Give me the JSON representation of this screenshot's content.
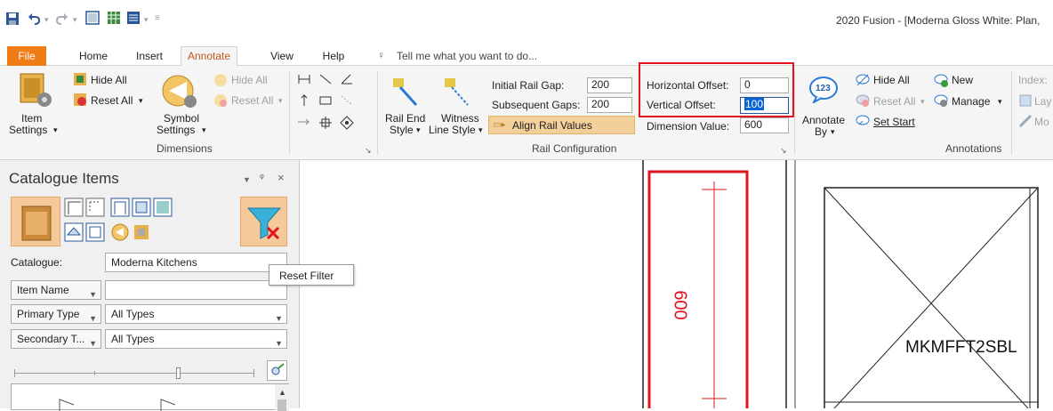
{
  "window": {
    "title": "2020 Fusion - [Moderna Gloss White: Plan,"
  },
  "tabs": {
    "file": "File",
    "home": "Home",
    "insert": "Insert",
    "annotate": "Annotate",
    "view": "View",
    "help": "Help",
    "tell_me": "Tell me what you want to do..."
  },
  "dimensions": {
    "hide_all": "Hide All",
    "reset_all": "Reset All",
    "item_settings_1": "Item",
    "item_settings_2": "Settings",
    "symbol_hide_all": "Hide All",
    "symbol_reset_all": "Reset All",
    "symbol_settings_1": "Symbol",
    "symbol_settings_2": "Settings",
    "group_label": "Dimensions"
  },
  "rail": {
    "rail_end_1": "Rail End",
    "rail_end_2": "Style",
    "witness_1": "Witness",
    "witness_2": "Line Style",
    "initial_gap_label": "Initial Rail Gap:",
    "initial_gap_value": "200",
    "subsequent_label": "Subsequent Gaps:",
    "subsequent_value": "200",
    "align": "Align Rail Values",
    "horizontal_label": "Horizontal Offset:",
    "horizontal_value": "0",
    "vertical_label": "Vertical Offset:",
    "vertical_value": "100",
    "dimension_label": "Dimension Value:",
    "dimension_value": "600",
    "group_label": "Rail Configuration"
  },
  "annotations": {
    "badge": "123",
    "annotate_1": "Annotate",
    "annotate_2": "By",
    "hide_all": "Hide All",
    "reset_all": "Reset All",
    "set_start": "Set Start",
    "new": "New",
    "manage": "Manage",
    "index": "Index:",
    "lay": "Lay",
    "mo": "Mo",
    "group_label": "Annotations"
  },
  "panel": {
    "title": "Catalogue Items",
    "catalogue_label": "Catalogue:",
    "catalogue_value": "Moderna Kitchens",
    "reset_filter": "Reset Filter",
    "item_name": "Item Name",
    "primary_type": "Primary Type",
    "primary_value": "All Types",
    "secondary_type": "Secondary T...",
    "secondary_value": "All Types"
  },
  "canvas": {
    "dimension_text": "600",
    "item_code": "MKMFFT2SBL"
  }
}
